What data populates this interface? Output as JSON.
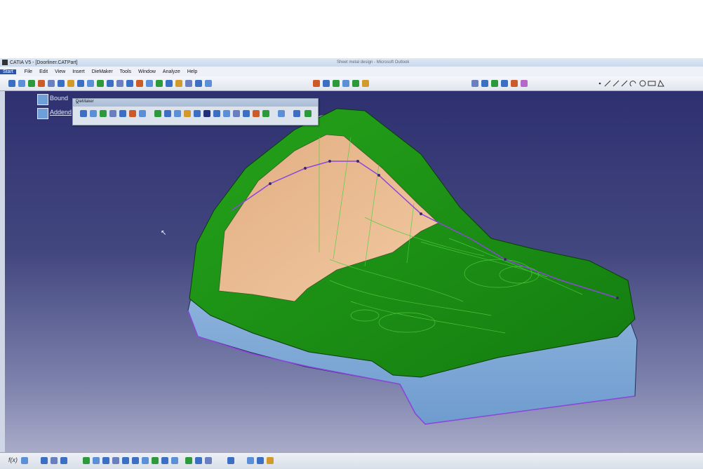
{
  "window": {
    "title": "CATIA V5 - [Doorliner.CATPart]",
    "background_title": "Sheet metal design - Microsoft Outlook"
  },
  "menu": {
    "items": [
      "Start",
      "File",
      "Edit",
      "View",
      "Insert",
      "DieMaker",
      "Tools",
      "Window",
      "Analyze",
      "Help"
    ]
  },
  "tree": {
    "items": [
      {
        "label": "Bound"
      },
      {
        "label": "Addend"
      }
    ]
  },
  "diemaker_toolbar": {
    "title": "DieMaker",
    "close": "×"
  },
  "bottom_toolbar": {
    "formula_label": "f(x)"
  },
  "colors": {
    "viewport_top": "#2e3070",
    "viewport_bottom": "#a9abc8",
    "part_green": "#1f9a18",
    "part_tan": "#e9b98d",
    "part_blue": "#8fb6dc",
    "edge_purple": "#8a48d9"
  },
  "icons": [
    "catia-logo-icon",
    "cursor-icon"
  ]
}
